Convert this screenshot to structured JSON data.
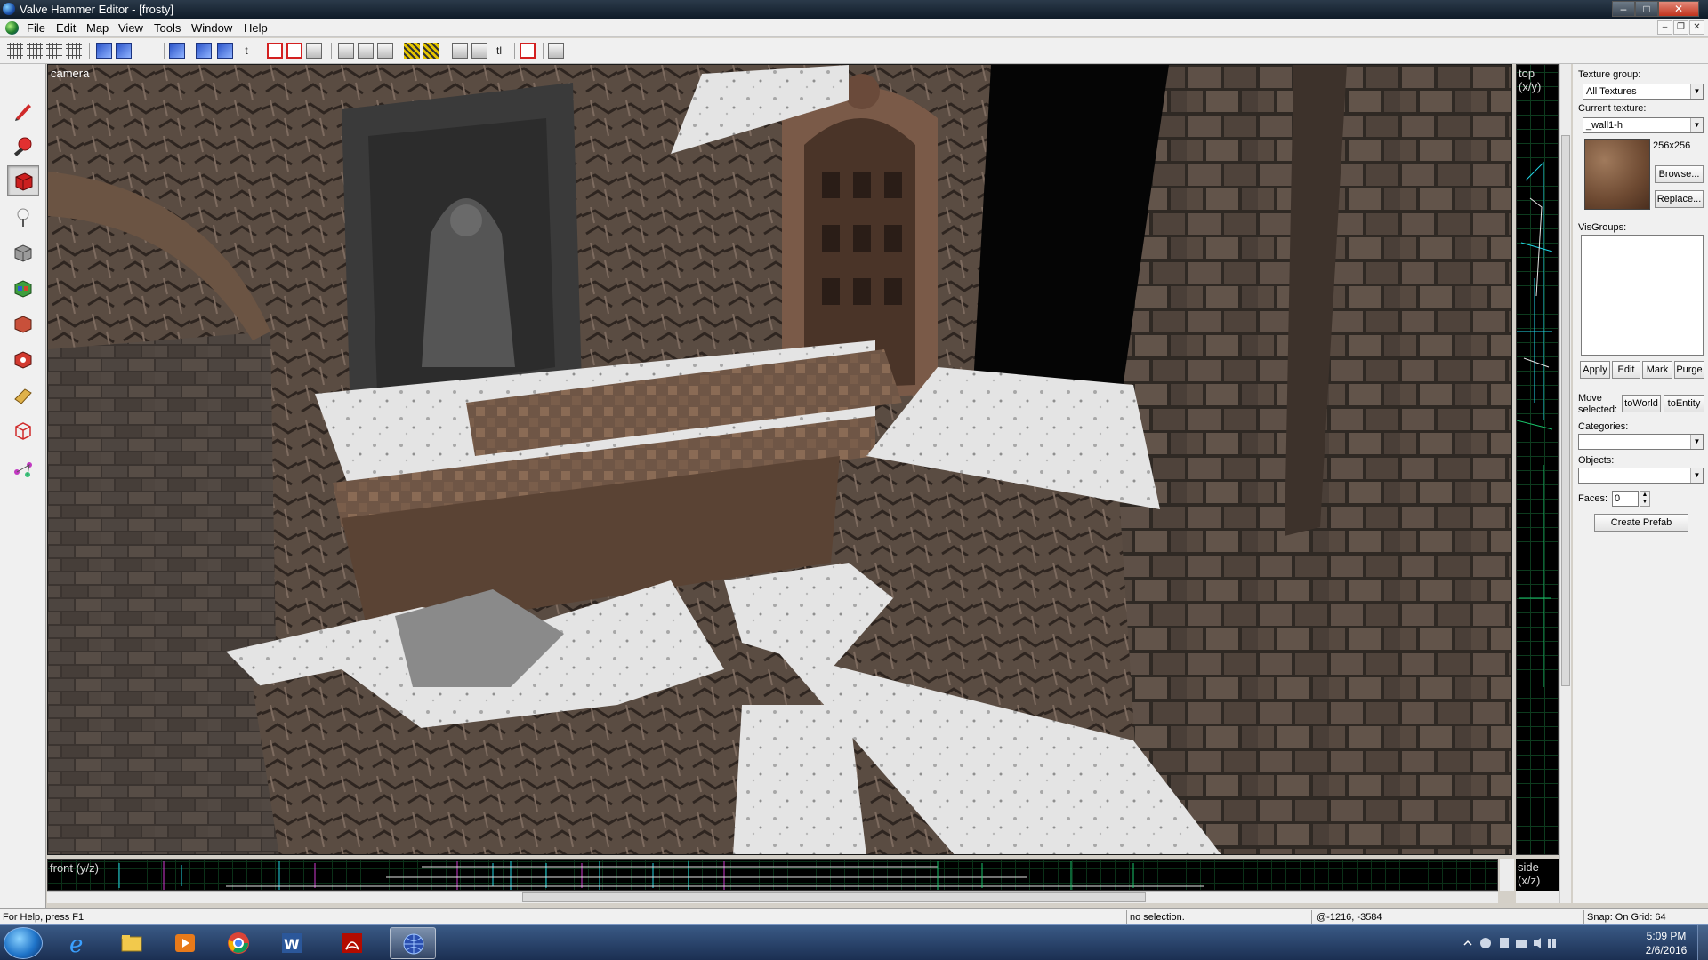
{
  "window": {
    "title": "Valve Hammer Editor - [frosty]"
  },
  "window_controls": {
    "minimize": "–",
    "maximize": "□",
    "close": "✕"
  },
  "menu": {
    "items": [
      "File",
      "Edit",
      "Map",
      "View",
      "Tools",
      "Window",
      "Help"
    ],
    "mdi": {
      "minimize": "–",
      "restore": "❐",
      "close": "✕"
    }
  },
  "toolbar": {
    "text_tool_1": "t",
    "text_tool_2": "tl"
  },
  "views": {
    "camera": "camera",
    "top": "top (x/y)",
    "front": "front (y/z)",
    "side": "side (x/z)"
  },
  "texture_panel": {
    "texture_group_label": "Texture group:",
    "texture_group_value": "All Textures",
    "current_texture_label": "Current texture:",
    "current_texture_value": "_wall1-h",
    "texture_size": "256x256",
    "browse_label": "Browse...",
    "replace_label": "Replace...",
    "visgroups_label": "VisGroups:",
    "apply_label": "Apply",
    "edit_label": "Edit",
    "mark_label": "Mark",
    "purge_label": "Purge",
    "move_selected_line1": "Move",
    "move_selected_line2": "selected:",
    "to_world_label": "toWorld",
    "to_entity_label": "toEntity",
    "categories_label": "Categories:",
    "categories_value": "",
    "objects_label": "Objects:",
    "objects_value": "",
    "faces_label": "Faces:",
    "faces_value": "0",
    "create_prefab_label": "Create Prefab"
  },
  "statusbar": {
    "help": "For Help, press F1",
    "selection": "no selection.",
    "coords": "@-1216, -3584",
    "snap": "Snap: On Grid: 64"
  },
  "taskbar": {
    "time": "5:09 PM",
    "date": "2/6/2016"
  }
}
